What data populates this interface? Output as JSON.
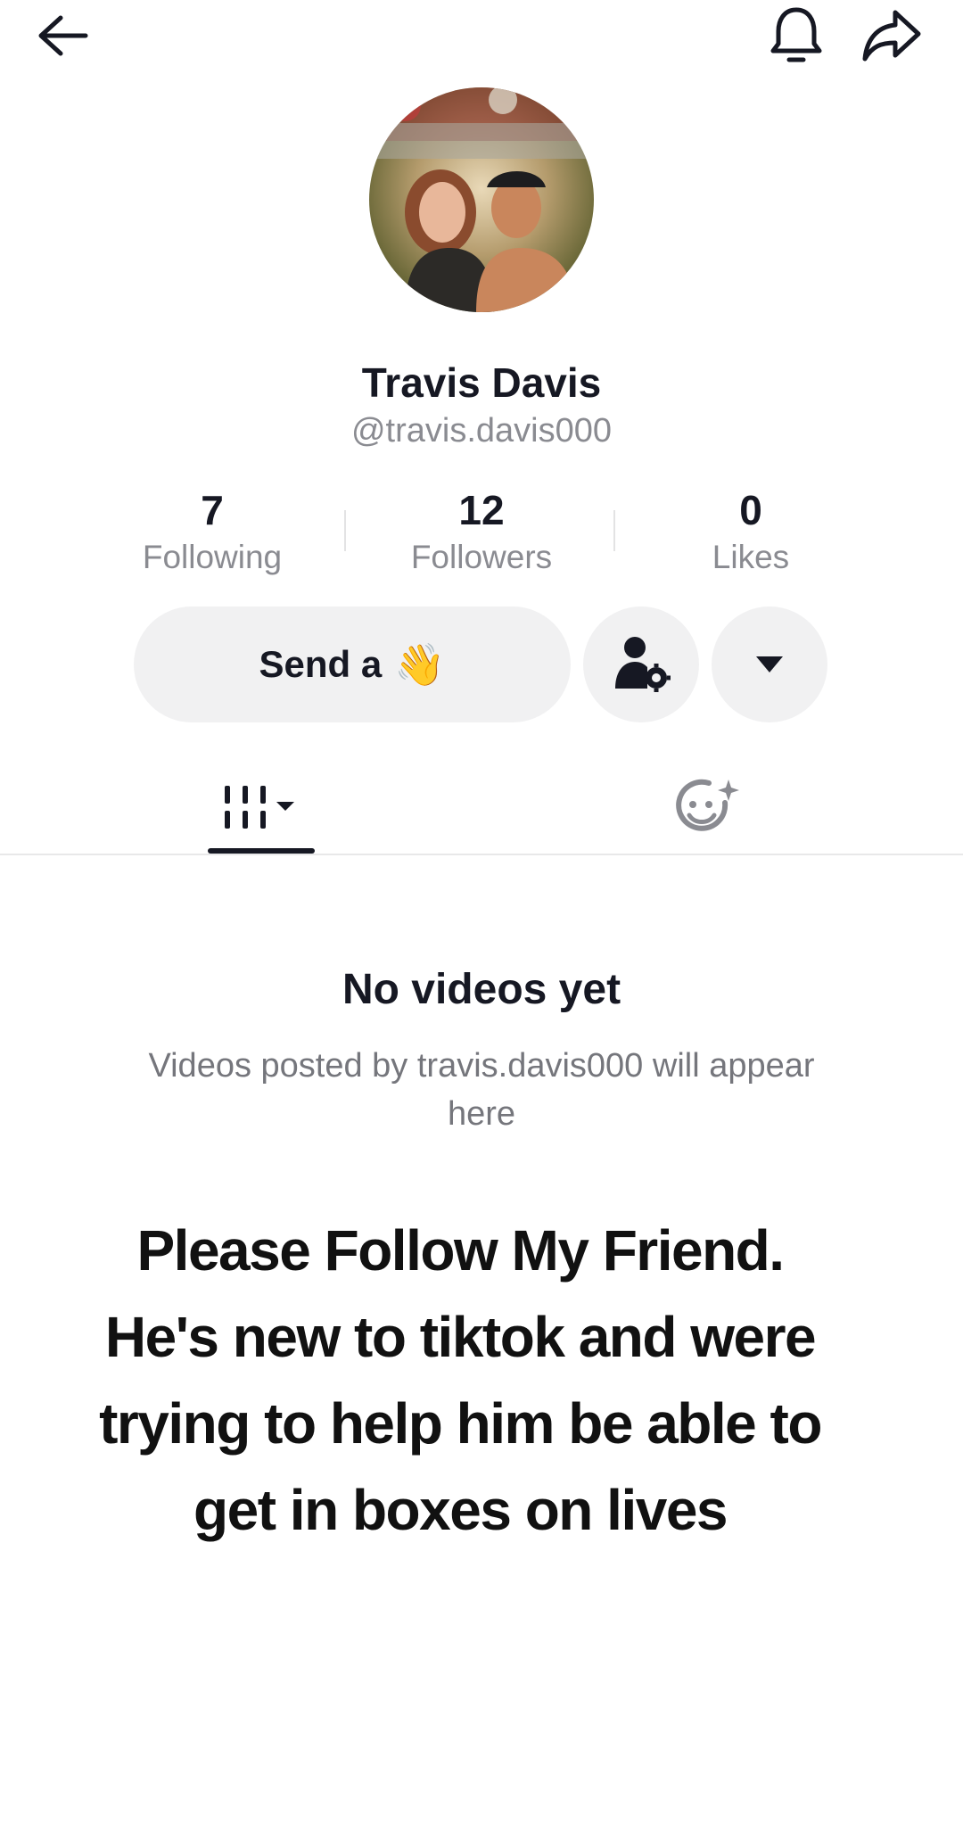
{
  "profile": {
    "name": "Travis Davis",
    "handle": "@travis.davis000"
  },
  "stats": [
    {
      "value": "7",
      "label": "Following"
    },
    {
      "value": "12",
      "label": "Followers"
    },
    {
      "value": "0",
      "label": "Likes"
    }
  ],
  "actions": {
    "send_label": "Send a",
    "wave_emoji": "👋"
  },
  "empty_state": {
    "title": "No videos yet",
    "subtitle": "Videos posted by travis.davis000 will appear here"
  },
  "caption": {
    "line1": "Please Follow My Friend.",
    "line2": "He's new to tiktok and were",
    "line3": "trying to help him be able to",
    "line4": "get in boxes on lives"
  },
  "icons": {
    "back": "back-arrow-icon",
    "bell": "bell-icon",
    "share": "share-icon",
    "profile_settings": "person-gear-icon",
    "dropdown": "caret-down-icon",
    "videos_tab": "video-grid-icon",
    "reposts_tab": "smile-sparkle-icon"
  },
  "colors": {
    "text_primary": "#161823",
    "text_secondary": "#8a8b91",
    "button_bg": "#f1f1f2",
    "wave_emoji": "#f6c441"
  }
}
